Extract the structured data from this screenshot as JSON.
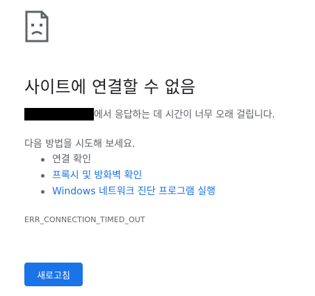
{
  "error_page": {
    "icon": "sad-page-icon",
    "title": "사이트에 연결할 수 없음",
    "description_suffix": "에서 응답하는 데 시간이 너무 오래 걸립니다.",
    "try_text": "다음 방법을 시도해 보세요.",
    "suggestions": [
      {
        "label": "연결 확인",
        "is_link": false
      },
      {
        "label": "프록시 및 방화벽 확인",
        "is_link": true
      },
      {
        "label": "Windows 네트워크 진단 프로그램 실행",
        "is_link": true
      }
    ],
    "error_code": "ERR_CONNECTION_TIMED_OUT",
    "reload_label": "새로고침"
  },
  "colors": {
    "link": "#1a73e8",
    "button": "#1a73e8",
    "text_secondary": "#5f6368",
    "title": "#202124",
    "redaction": "#000000"
  }
}
